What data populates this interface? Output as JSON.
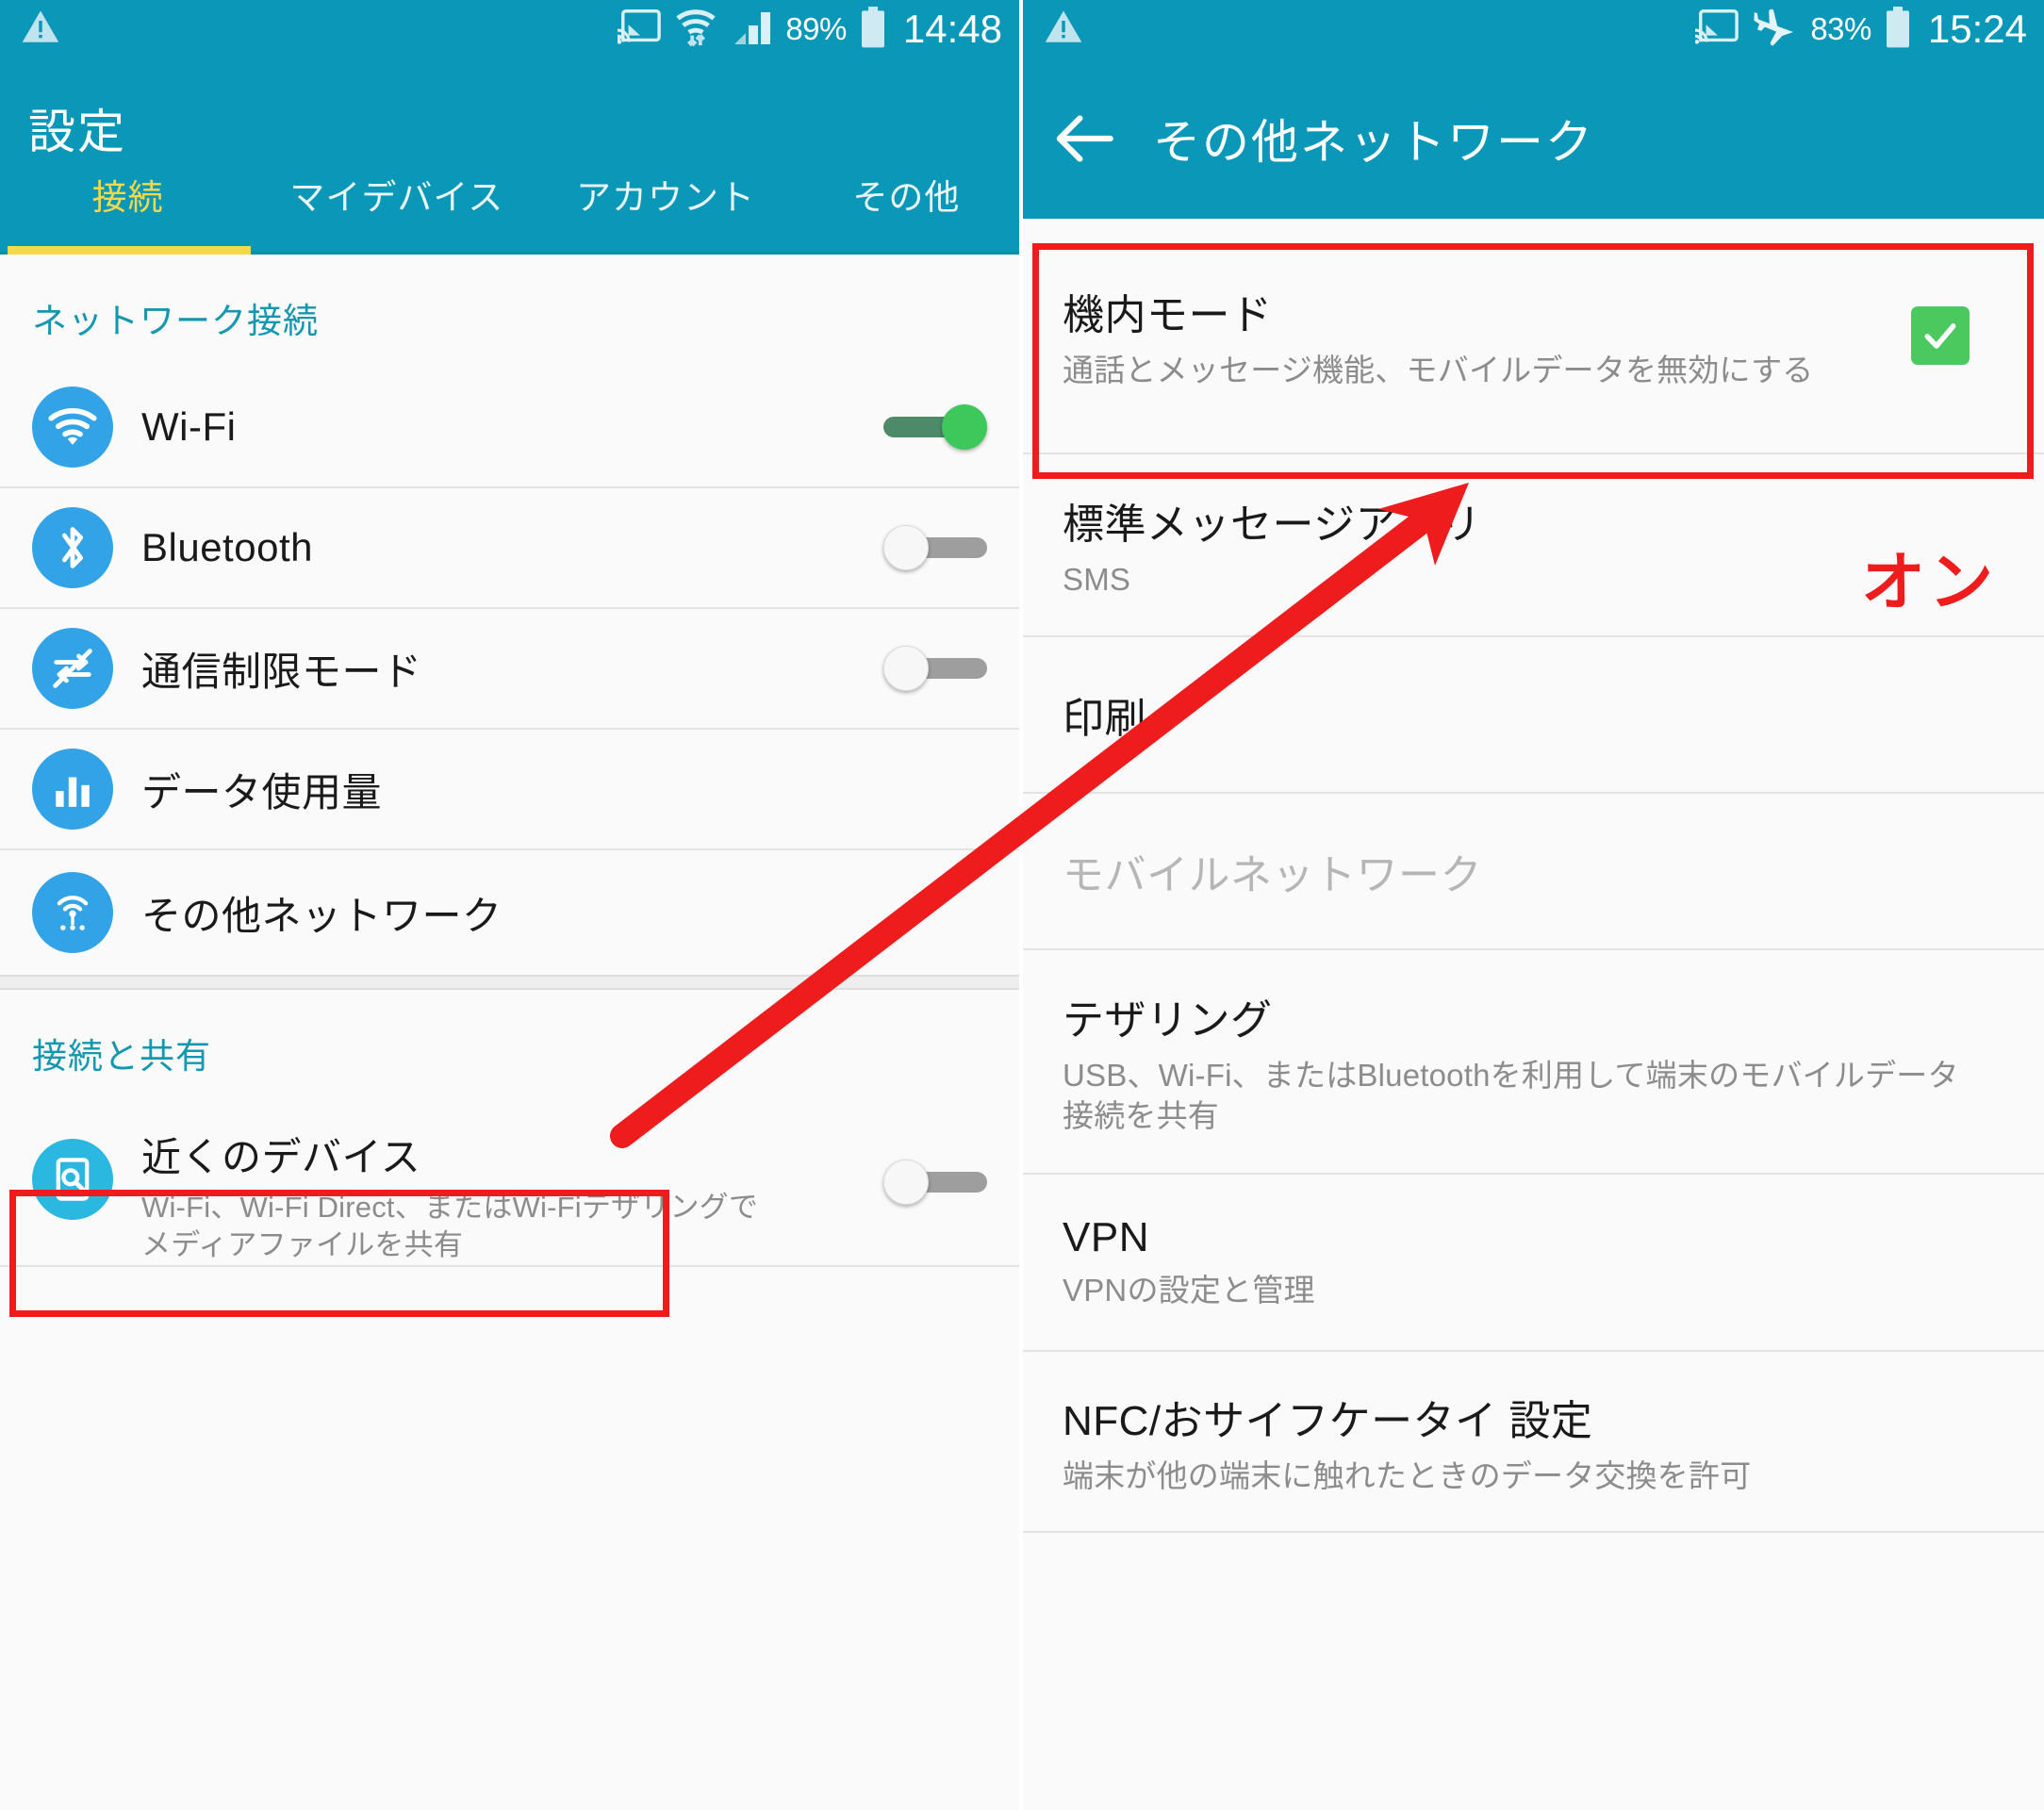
{
  "colors": {
    "teal": "#0a97b8",
    "accent_yellow": "#f4d94a",
    "annotation_red": "#ee1c1c",
    "toggle_on_green": "#3ec75a",
    "checkbox_green": "#4bc95f",
    "icon_blue": "#33a3e8",
    "section_header_teal": "#1597b0"
  },
  "left_screen": {
    "statusbar": {
      "warning_icon": "warning-triangle-icon",
      "cast_icon": "screen-cast-icon",
      "wifi_icon": "wifi-transfer-icon",
      "signal_icon": "cellular-signal-icon",
      "battery_percent": "89%",
      "battery_icon": "battery-icon",
      "time": "14:48"
    },
    "appbar": {
      "title": "設定"
    },
    "tabs": [
      {
        "label": "接続",
        "active": true
      },
      {
        "label": "マイデバイス",
        "active": false
      },
      {
        "label": "アカウント",
        "active": false
      },
      {
        "label": "その他",
        "active": false
      }
    ],
    "sections": [
      {
        "header": "ネットワーク接続",
        "items": [
          {
            "title": "Wi-Fi",
            "icon": "wifi-icon",
            "control": "toggle",
            "state": "on"
          },
          {
            "title": "Bluetooth",
            "icon": "bluetooth-icon",
            "control": "toggle",
            "state": "off"
          },
          {
            "title": "通信制限モード",
            "icon": "data-restriction-icon",
            "control": "toggle",
            "state": "off"
          },
          {
            "title": "データ使用量",
            "icon": "data-usage-icon",
            "control": "none"
          },
          {
            "title": "その他ネットワーク",
            "icon": "other-networks-icon",
            "control": "none",
            "highlighted": true
          }
        ]
      },
      {
        "header": "接続と共有",
        "items": [
          {
            "title": "近くのデバイス",
            "subtitle": "Wi-Fi、Wi-Fi Direct、またはWi-Fiテザリングでメディアファイルを共有",
            "icon": "nearby-devices-icon",
            "control": "toggle",
            "state": "off"
          }
        ]
      }
    ]
  },
  "right_screen": {
    "statusbar": {
      "warning_icon": "warning-triangle-icon",
      "cast_icon": "screen-cast-icon",
      "airplane_icon": "airplane-mode-icon",
      "battery_percent": "83%",
      "battery_icon": "battery-icon",
      "time": "15:24"
    },
    "appbar": {
      "back_icon": "back-arrow-icon",
      "title": "その他ネットワーク"
    },
    "items": [
      {
        "title": "機内モード",
        "subtitle": "通話とメッセージ機能、モバイルデータを無効にする",
        "control": "checkbox",
        "state": "checked",
        "highlighted": true
      },
      {
        "title": "標準メッセージアプリ",
        "subtitle": "SMS",
        "control": "none"
      },
      {
        "title": "印刷",
        "subtitle": "",
        "control": "none"
      },
      {
        "title": "モバイルネットワーク",
        "subtitle": "",
        "control": "none",
        "disabled": true
      },
      {
        "title": "テザリング",
        "subtitle": "USB、Wi-Fi、またはBluetoothを利用して端末のモバイルデータ接続を共有",
        "control": "none"
      },
      {
        "title": "VPN",
        "subtitle": "VPNの設定と管理",
        "control": "none"
      },
      {
        "title": "NFC/おサイフケータイ 設定",
        "subtitle": "端末が他の端末に触れたときのデータ交換を許可",
        "control": "none"
      }
    ]
  },
  "annotations": {
    "on_label": "オン",
    "arrow": "red-pointer-arrow",
    "boxes": [
      "その他ネットワーク",
      "機内モード"
    ]
  }
}
